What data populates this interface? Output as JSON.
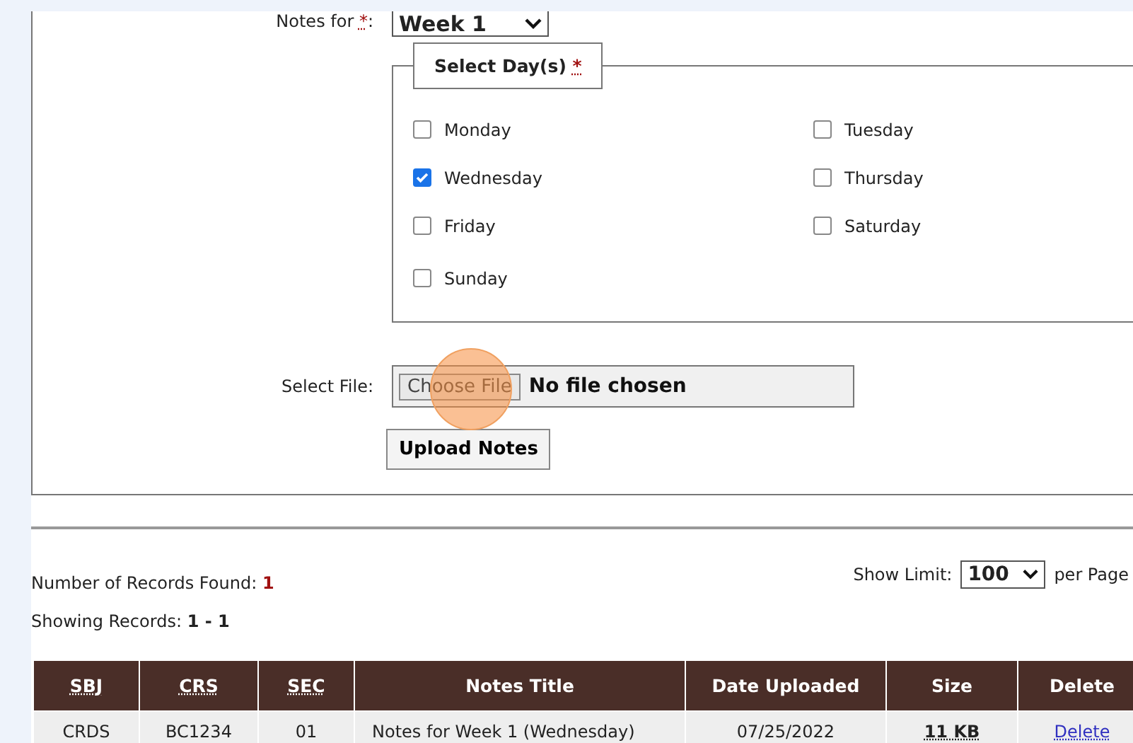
{
  "form": {
    "notes_for": {
      "label": "Notes for",
      "required_mark": "*",
      "separator": ":",
      "value": "Week 1"
    },
    "days": {
      "legend": "Select Day(s)",
      "required_mark": "*",
      "items": [
        {
          "label": "Monday",
          "checked": false
        },
        {
          "label": "Tuesday",
          "checked": false
        },
        {
          "label": "Wednesday",
          "checked": true
        },
        {
          "label": "Thursday",
          "checked": false
        },
        {
          "label": "Friday",
          "checked": false
        },
        {
          "label": "Saturday",
          "checked": false
        },
        {
          "label": "Sunday",
          "checked": false
        }
      ]
    },
    "file": {
      "label": "Select File:",
      "button": "Choose File",
      "status": "No file chosen"
    },
    "upload_button": "Upload Notes"
  },
  "records": {
    "found_label": "Number of Records Found:",
    "found": "1",
    "showing_label": "Showing Records:",
    "showing": "1 - 1",
    "limit_label": "Show Limit:",
    "limit": "100",
    "per_page": "per Page"
  },
  "table": {
    "columns": [
      {
        "label": "SBJ",
        "abbr": true
      },
      {
        "label": "CRS",
        "abbr": true
      },
      {
        "label": "SEC",
        "abbr": true
      },
      {
        "label": "Notes Title",
        "abbr": false
      },
      {
        "label": "Date Uploaded",
        "abbr": false
      },
      {
        "label": "Size",
        "abbr": false
      },
      {
        "label": "Delete",
        "abbr": false
      }
    ],
    "rows": [
      {
        "cells": [
          "CRDS",
          "BC1234",
          "01",
          "Notes for Week 1 (Wednesday)",
          "07/25/2022",
          "11 KB",
          "Delete"
        ]
      }
    ]
  }
}
